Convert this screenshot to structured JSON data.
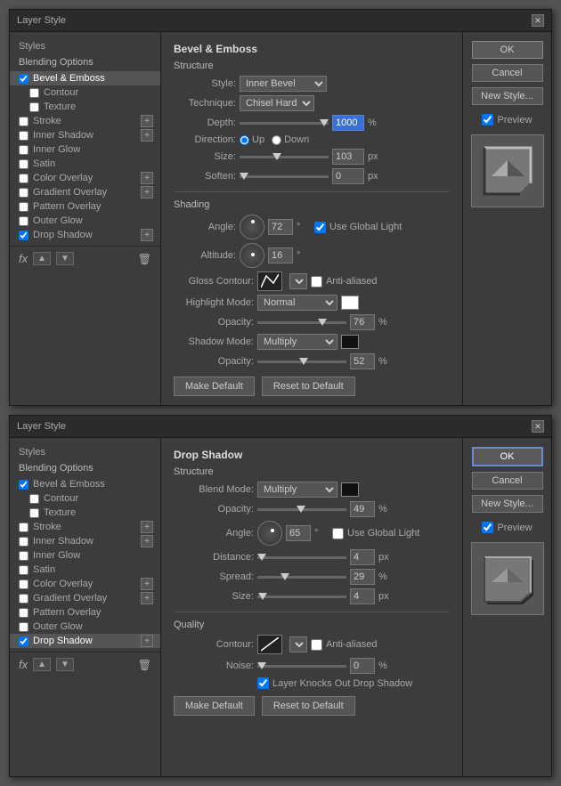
{
  "dialog1": {
    "title": "Layer Style",
    "section": "Bevel & Emboss",
    "subsection": "Structure",
    "style_label": "Style:",
    "style_value": "Inner Bevel",
    "technique_label": "Technique:",
    "technique_value": "Chisel Hard",
    "depth_label": "Depth:",
    "depth_value": "1000",
    "depth_unit": "%",
    "direction_label": "Direction:",
    "direction_up": "Up",
    "direction_down": "Down",
    "size_label": "Size:",
    "size_value": "103",
    "size_unit": "px",
    "soften_label": "Soften:",
    "soften_value": "0",
    "soften_unit": "px",
    "shading_title": "Shading",
    "angle_label": "Angle:",
    "angle_value": "72",
    "angle_symbol": "°",
    "global_light_label": "Use Global Light",
    "altitude_label": "Altitude:",
    "altitude_value": "16",
    "altitude_symbol": "°",
    "gloss_contour_label": "Gloss Contour:",
    "anti_aliased_label": "Anti-aliased",
    "highlight_mode_label": "Highlight Mode:",
    "highlight_mode_value": "Normal",
    "highlight_opacity_label": "Opacity:",
    "highlight_opacity_value": "76",
    "highlight_opacity_unit": "%",
    "shadow_mode_label": "Shadow Mode:",
    "shadow_mode_value": "Multiply",
    "shadow_opacity_label": "Opacity:",
    "shadow_opacity_value": "52",
    "shadow_opacity_unit": "%",
    "make_default_btn": "Make Default",
    "reset_to_default_btn": "Reset to Default",
    "ok_btn": "OK",
    "cancel_btn": "Cancel",
    "new_style_btn": "New Style...",
    "preview_label": "Preview",
    "left_panel": {
      "styles_title": "Styles",
      "blending_options": "Blending Options",
      "items": [
        {
          "label": "Bevel & Emboss",
          "checked": true,
          "active": true,
          "has_plus": false
        },
        {
          "label": "Contour",
          "checked": false,
          "active": false,
          "has_plus": false,
          "indent": true
        },
        {
          "label": "Texture",
          "checked": false,
          "active": false,
          "has_plus": false,
          "indent": true
        },
        {
          "label": "Stroke",
          "checked": false,
          "active": false,
          "has_plus": true
        },
        {
          "label": "Inner Shadow",
          "checked": false,
          "active": false,
          "has_plus": true
        },
        {
          "label": "Inner Glow",
          "checked": false,
          "active": false,
          "has_plus": false
        },
        {
          "label": "Satin",
          "checked": false,
          "active": false,
          "has_plus": false
        },
        {
          "label": "Color Overlay",
          "checked": false,
          "active": false,
          "has_plus": true
        },
        {
          "label": "Gradient Overlay",
          "checked": false,
          "active": false,
          "has_plus": true
        },
        {
          "label": "Pattern Overlay",
          "checked": false,
          "active": false,
          "has_plus": false
        },
        {
          "label": "Outer Glow",
          "checked": false,
          "active": false,
          "has_plus": false
        },
        {
          "label": "Drop Shadow",
          "checked": true,
          "active": false,
          "has_plus": true
        }
      ]
    }
  },
  "dialog2": {
    "title": "Layer Style",
    "section": "Drop Shadow",
    "subsection": "Structure",
    "blend_mode_label": "Blend Mode:",
    "blend_mode_value": "Multiply",
    "opacity_label": "Opacity:",
    "opacity_value": "49",
    "opacity_unit": "%",
    "angle_label": "Angle:",
    "angle_value": "65",
    "angle_symbol": "°",
    "global_light_label": "Use Global Light",
    "distance_label": "Distance:",
    "distance_value": "4",
    "distance_unit": "px",
    "spread_label": "Spread:",
    "spread_value": "29",
    "spread_unit": "%",
    "size_label": "Size:",
    "size_value": "4",
    "size_unit": "px",
    "quality_title": "Quality",
    "contour_label": "Contour:",
    "anti_aliased_label": "Anti-aliased",
    "noise_label": "Noise:",
    "noise_value": "0",
    "noise_unit": "%",
    "layer_knocks_out_label": "Layer Knocks Out Drop Shadow",
    "make_default_btn": "Make Default",
    "reset_to_default_btn": "Reset to Default",
    "ok_btn": "OK",
    "cancel_btn": "Cancel",
    "new_style_btn": "New Style...",
    "preview_label": "Preview",
    "left_panel": {
      "styles_title": "Styles",
      "blending_options": "Blending Options",
      "items": [
        {
          "label": "Bevel & Emboss",
          "checked": true,
          "active": false,
          "has_plus": false
        },
        {
          "label": "Contour",
          "checked": false,
          "active": false,
          "has_plus": false,
          "indent": true
        },
        {
          "label": "Texture",
          "checked": false,
          "active": false,
          "has_plus": false,
          "indent": true
        },
        {
          "label": "Stroke",
          "checked": false,
          "active": false,
          "has_plus": true
        },
        {
          "label": "Inner Shadow",
          "checked": false,
          "active": false,
          "has_plus": true
        },
        {
          "label": "Inner Glow",
          "checked": false,
          "active": false,
          "has_plus": false
        },
        {
          "label": "Satin",
          "checked": false,
          "active": false,
          "has_plus": false
        },
        {
          "label": "Color Overlay",
          "checked": false,
          "active": false,
          "has_plus": true
        },
        {
          "label": "Gradient Overlay",
          "checked": false,
          "active": false,
          "has_plus": true
        },
        {
          "label": "Pattern Overlay",
          "checked": false,
          "active": false,
          "has_plus": false
        },
        {
          "label": "Outer Glow",
          "checked": false,
          "active": false,
          "has_plus": false
        },
        {
          "label": "Drop Shadow",
          "checked": true,
          "active": true,
          "has_plus": true
        }
      ]
    }
  }
}
